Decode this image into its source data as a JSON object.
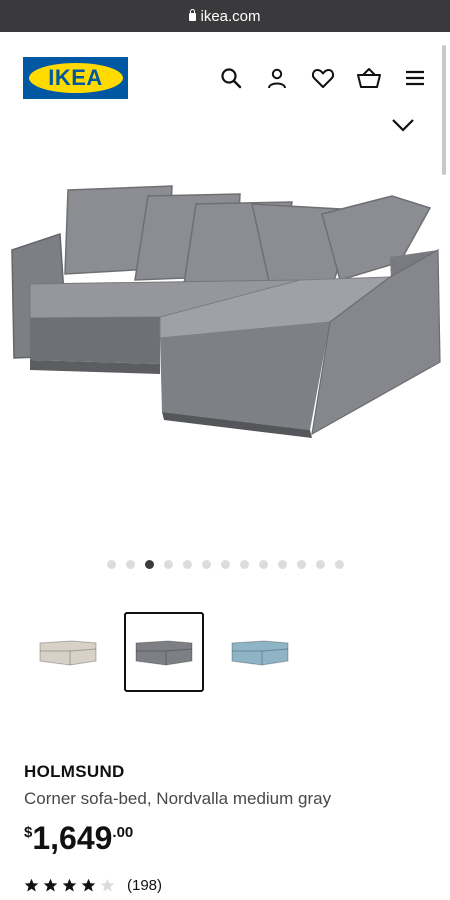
{
  "browser": {
    "url": "ikea.com"
  },
  "header": {
    "logo_text": "IKEA",
    "icons": [
      "search-icon",
      "account-icon",
      "heart-icon",
      "cart-icon",
      "menu-icon"
    ]
  },
  "gallery": {
    "total_images": 13,
    "active_index": 2,
    "thumbnails": [
      {
        "color_name": "beige",
        "color": "#d8d1c7",
        "selected": false
      },
      {
        "color_name": "medium gray",
        "color": "#7d7f84",
        "selected": true
      },
      {
        "color_name": "light blue",
        "color": "#8fb4c6",
        "selected": false
      }
    ]
  },
  "product": {
    "name": "HOLMSUND",
    "description": "Corner sofa-bed, Nordvalla medium gray",
    "currency": "$",
    "price_int": "1,649",
    "price_dec": ".00",
    "rating_value": 4,
    "rating_max": 5,
    "review_count": "(198)"
  }
}
